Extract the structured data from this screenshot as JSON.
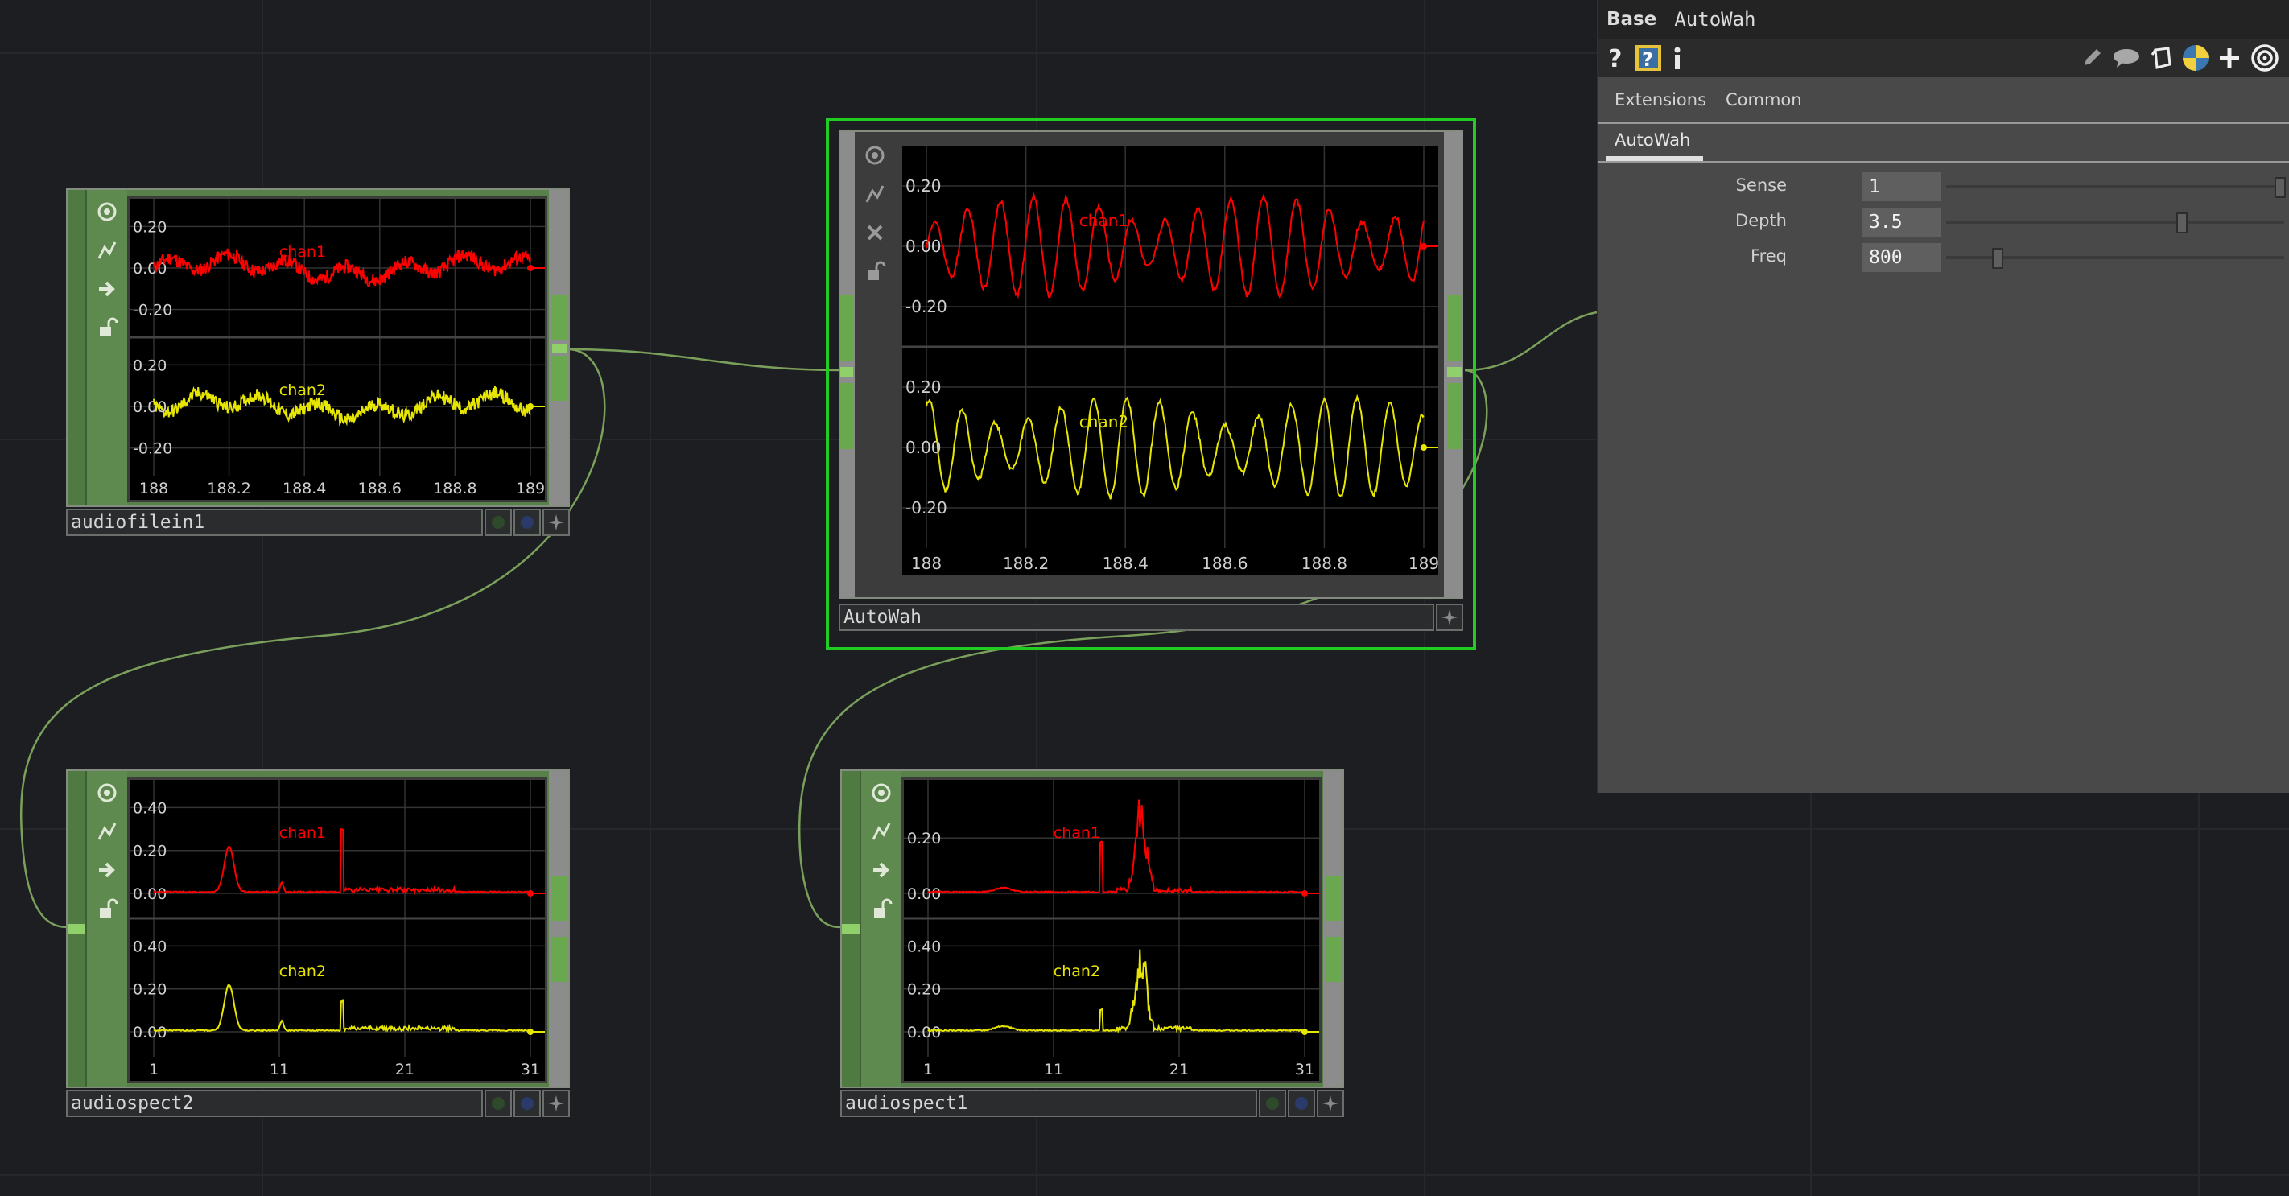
{
  "network": {
    "background_color": "#1c1e21",
    "wire_color": "#7ba05b"
  },
  "nodes": [
    {
      "id": "audiofilein1",
      "name": "audiofilein1",
      "kind": "waveform",
      "channels": [
        {
          "name": "chan1",
          "color": "#ff0000",
          "ticks": [
            "0.20",
            "0.00",
            "-0.20"
          ]
        },
        {
          "name": "chan2",
          "color": "#e6e600",
          "ticks": [
            "0.20",
            "0.00",
            "-0.20"
          ]
        }
      ],
      "x_ticks": [
        "188",
        "188.2",
        "188.4",
        "188.6",
        "188.8",
        "189"
      ]
    },
    {
      "id": "autowah",
      "name": "AutoWah",
      "kind": "waveform",
      "selected": true,
      "channels": [
        {
          "name": "chan1",
          "color": "#ff0000",
          "ticks": [
            "0.20",
            "0.00",
            "-0.20"
          ]
        },
        {
          "name": "chan2",
          "color": "#e6e600",
          "ticks": [
            "0.20",
            "0.00",
            "-0.20"
          ]
        }
      ],
      "x_ticks": [
        "188",
        "188.2",
        "188.4",
        "188.6",
        "188.8",
        "189"
      ]
    },
    {
      "id": "audiospect2",
      "name": "audiospect2",
      "kind": "spectrum",
      "channels": [
        {
          "name": "chan1",
          "color": "#ff0000",
          "ticks": [
            "0.40",
            "0.20",
            "0.00"
          ]
        },
        {
          "name": "chan2",
          "color": "#e6e600",
          "ticks": [
            "0.40",
            "0.20",
            "0.00"
          ]
        }
      ],
      "x_ticks": [
        "1",
        "11",
        "21",
        "31"
      ]
    },
    {
      "id": "audiospect1",
      "name": "audiospect1",
      "kind": "spectrum",
      "channels": [
        {
          "name": "chan1",
          "color": "#ff0000",
          "ticks": [
            "0.20",
            "0.00"
          ]
        },
        {
          "name": "chan2",
          "color": "#e6e600",
          "ticks": [
            "0.40",
            "0.20",
            "0.00"
          ]
        }
      ],
      "x_ticks": [
        "1",
        "11",
        "21",
        "31"
      ]
    }
  ],
  "panel": {
    "op_type": "Base",
    "op_name": "AutoWah",
    "toolbar_left": [
      "help-icon",
      "python-help-icon",
      "info-icon"
    ],
    "toolbar_right": [
      "edit-icon",
      "comment-icon",
      "clone-icon",
      "python-icon",
      "add-icon",
      "target-icon"
    ],
    "tabs": [
      "Extensions",
      "Common"
    ],
    "active_page": "AutoWah",
    "params": [
      {
        "label": "Sense",
        "value": "1",
        "slider": 1.0
      },
      {
        "label": "Depth",
        "value": "3.5",
        "slider": 0.7
      },
      {
        "label": "Freq",
        "value": "800",
        "slider": 0.14
      }
    ]
  }
}
